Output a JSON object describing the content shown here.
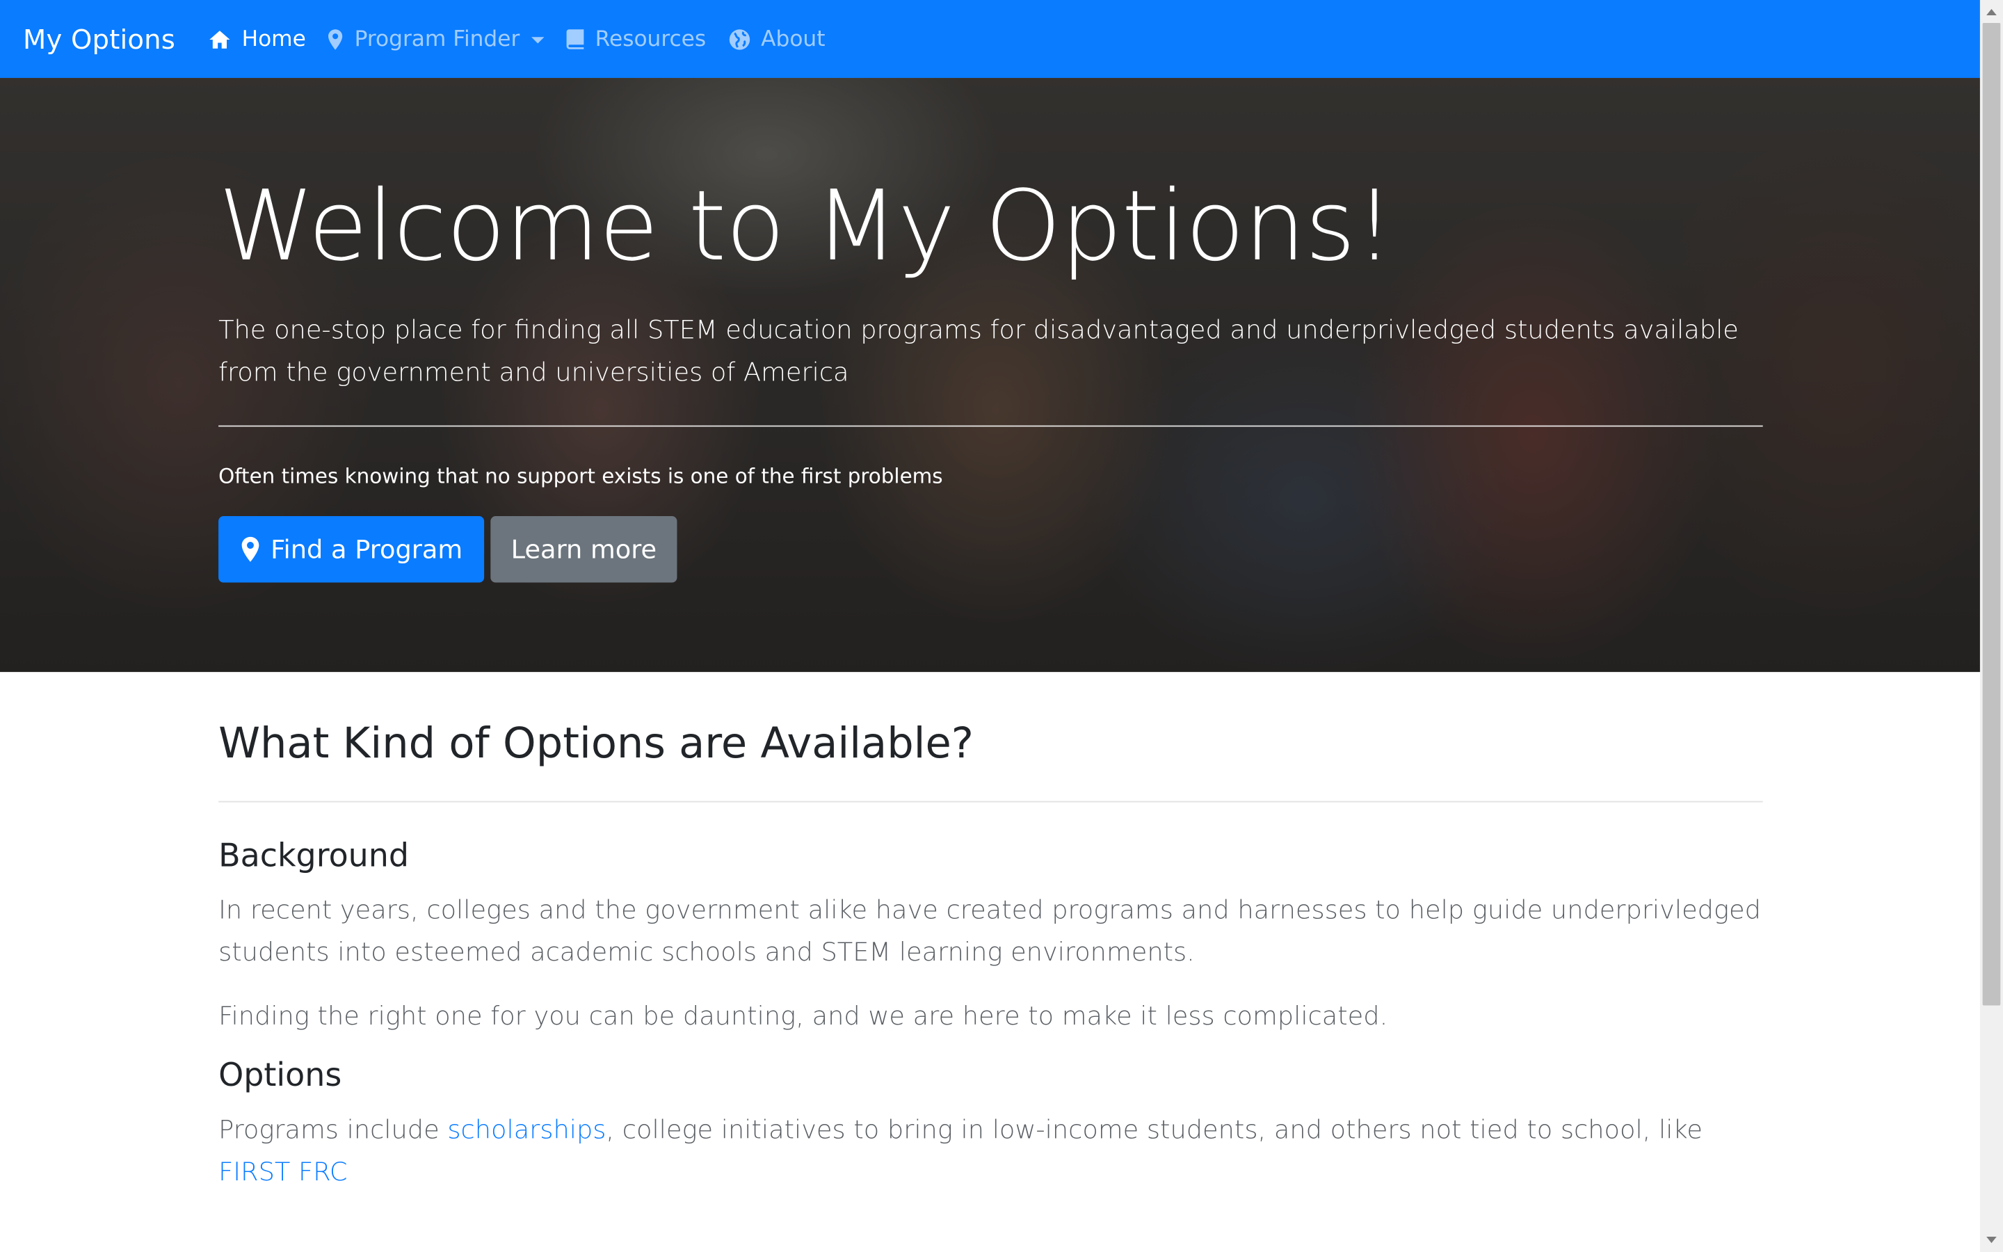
{
  "navbar": {
    "brand": "My Options",
    "items": [
      {
        "label": "Home",
        "icon": "home-icon",
        "active": true
      },
      {
        "label": "Program Finder",
        "icon": "map-marker-icon",
        "dropdown": true
      },
      {
        "label": "Resources",
        "icon": "book-icon"
      },
      {
        "label": "About",
        "icon": "globe-icon"
      }
    ],
    "background_color": "#0a7cff"
  },
  "hero": {
    "title": "Welcome to My Options!",
    "lead": "The one-stop place for finding all STEM education programs for disadvantaged and underprivledged students available from the government and universities of America",
    "note": "Often times knowing that no support exists is one of the first problems",
    "primary_button": "Find a Program",
    "secondary_button": "Learn more"
  },
  "content": {
    "section_title": "What Kind of Options are Available?",
    "background_heading": "Background",
    "background_p1": "In recent years, colleges and the government alike have created programs and harnesses to help guide underprivledged students into esteemed academic schools and STEM learning environments.",
    "background_p2": "Finding the right one for you can be daunting, and we are here to make it less complicated.",
    "options_heading": "Options",
    "options_prefix": "Programs include ",
    "options_link1": "scholarships",
    "options_middle": ", college initiatives to bring in low-income students, and others not tied to school, like ",
    "options_link2": "FIRST FRC"
  },
  "colors": {
    "primary": "#0a7cff",
    "secondary": "#6c757d",
    "link": "#0a7cff"
  }
}
